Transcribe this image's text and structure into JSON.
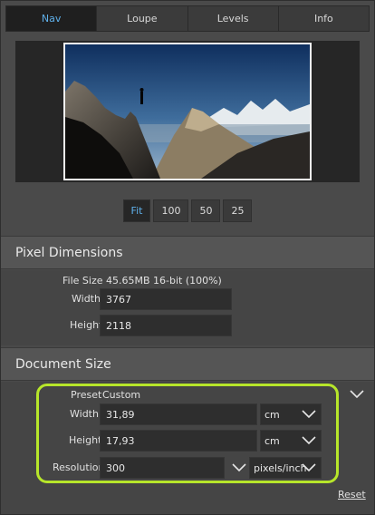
{
  "tabs": [
    {
      "label": "Nav",
      "active": true
    },
    {
      "label": "Loupe",
      "active": false
    },
    {
      "label": "Levels",
      "active": false
    },
    {
      "label": "Info",
      "active": false
    }
  ],
  "zoom": {
    "buttons": [
      "Fit",
      "100",
      "50",
      "25"
    ],
    "selected": "Fit"
  },
  "pixel_dimensions": {
    "title": "Pixel Dimensions",
    "file_size": "File Size 45.65MB 16-bit (100%)",
    "width_label": "Width",
    "width_value": "3767",
    "height_label": "Height",
    "height_value": "2118"
  },
  "document_size": {
    "title": "Document Size",
    "preset_label": "Preset",
    "preset_value": "Custom",
    "width_label": "Width",
    "width_value": "31,89",
    "width_unit": "cm",
    "height_label": "Height",
    "height_value": "17,93",
    "height_unit": "cm",
    "resolution_label": "Resolution",
    "resolution_value": "300",
    "resolution_unit": "pixels/inch",
    "reset_label": "Reset"
  },
  "colors": {
    "accent": "#5fb0ea",
    "highlight": "#b7e62a",
    "panel": "#454545",
    "header": "#555555"
  },
  "icons": {
    "chevron": "chevron-down-icon"
  }
}
